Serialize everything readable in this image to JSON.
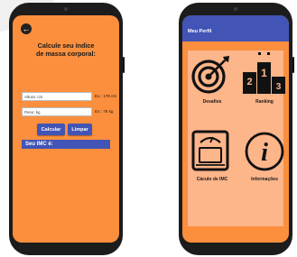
{
  "calculator": {
    "back_icon": "arrow-left-icon",
    "title_line1": "Calcule seu índice",
    "title_line2": "de massa corporal:",
    "height_placeholder": "Altura: cm",
    "height_hint": "Ex.: 178 cm",
    "weight_placeholder": "Peso: kg",
    "weight_hint": "Ex.: 78 kg",
    "calc_button": "Calcular",
    "clear_button": "Limpar",
    "result_label": "Seu IMC é:"
  },
  "profile": {
    "title": "Meu Perfil",
    "menu": [
      {
        "label": "Desafios",
        "icon": "target-icon"
      },
      {
        "label": "Ranking",
        "icon": "podium-icon"
      },
      {
        "label": "Cáculo de IMC",
        "icon": "scale-icon"
      },
      {
        "label": "Informações",
        "icon": "info-icon"
      }
    ]
  },
  "colors": {
    "screen_orange": "#fb8f3d",
    "panel_peach": "#fdb58a",
    "accent_blue": "#4254b5",
    "phone_body": "#1c1c1c"
  }
}
